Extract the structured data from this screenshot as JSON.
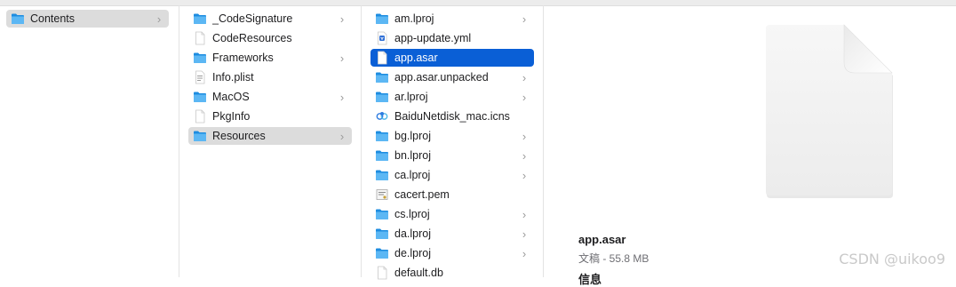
{
  "column1": {
    "items": [
      {
        "label": "Contents",
        "chevron": "›"
      }
    ]
  },
  "column2": {
    "items": [
      {
        "label": "_CodeSignature",
        "chevron": "›"
      },
      {
        "label": "CodeResources",
        "chevron": ""
      },
      {
        "label": "Frameworks",
        "chevron": "›"
      },
      {
        "label": "Info.plist",
        "chevron": ""
      },
      {
        "label": "MacOS",
        "chevron": "›"
      },
      {
        "label": "PkgInfo",
        "chevron": ""
      },
      {
        "label": "Resources",
        "chevron": "›"
      }
    ]
  },
  "column3": {
    "items": [
      {
        "label": "am.lproj",
        "chevron": "›"
      },
      {
        "label": "app-update.yml",
        "chevron": ""
      },
      {
        "label": "app.asar",
        "chevron": ""
      },
      {
        "label": "app.asar.unpacked",
        "chevron": "›"
      },
      {
        "label": "ar.lproj",
        "chevron": "›"
      },
      {
        "label": "BaiduNetdisk_mac.icns",
        "chevron": ""
      },
      {
        "label": "bg.lproj",
        "chevron": "›"
      },
      {
        "label": "bn.lproj",
        "chevron": "›"
      },
      {
        "label": "ca.lproj",
        "chevron": "›"
      },
      {
        "label": "cacert.pem",
        "chevron": ""
      },
      {
        "label": "cs.lproj",
        "chevron": "›"
      },
      {
        "label": "da.lproj",
        "chevron": "›"
      },
      {
        "label": "de.lproj",
        "chevron": "›"
      },
      {
        "label": "default.db",
        "chevron": ""
      }
    ]
  },
  "preview": {
    "name": "app.asar",
    "meta": "文稿 - 55.8 MB",
    "info_heading": "信息"
  },
  "watermark": "CSDN @uikoo9",
  "colors": {
    "selection_blue": "#0a5fd6",
    "selection_gray": "#dcdcdc",
    "folder_blue": "#3aa0ec"
  }
}
